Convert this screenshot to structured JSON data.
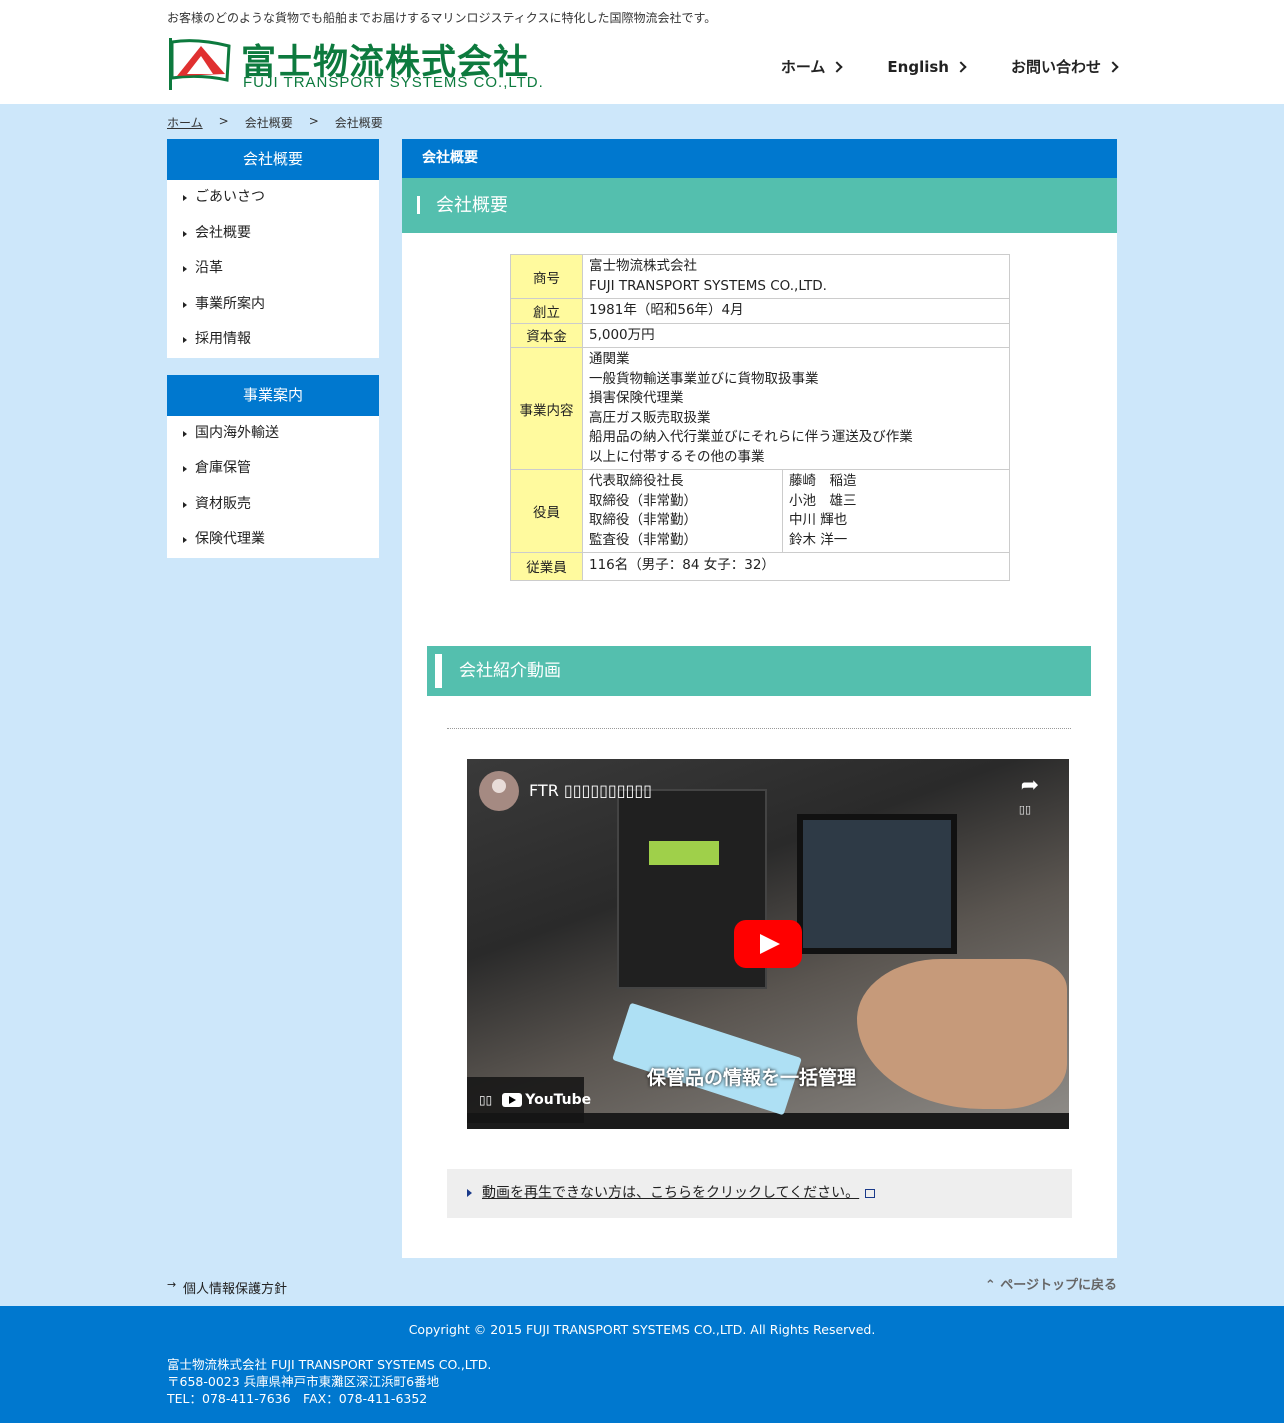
{
  "header": {
    "tagline": "お客様のどのような貨物でも船舶までお届けするマリンロジスティクスに特化した国際物流会社です。",
    "logo_jp": "富士物流株式会社",
    "logo_en": "FUJI TRANSPORT SYSTEMS CO.,LTD.",
    "nav": [
      {
        "label": "ホーム"
      },
      {
        "label": "English"
      },
      {
        "label": "お問い合わせ"
      }
    ]
  },
  "breadcrumb": {
    "home": "ホーム",
    "sep": ">",
    "level1": "会社概要",
    "level2": "会社概要"
  },
  "sidebar": {
    "company": {
      "heading": "会社概要",
      "items": [
        "ごあいさつ",
        "会社概要",
        "沿革",
        "事業所案内",
        "採用情報"
      ]
    },
    "business": {
      "heading": "事業案内",
      "items": [
        "国内海外輸送",
        "倉庫保管",
        "資材販売",
        "保険代理業"
      ]
    }
  },
  "main": {
    "page_heading": "会社概要",
    "section_heading": "会社概要",
    "table": {
      "name_label": "商号",
      "name_jp": "富士物流株式会社",
      "name_en": "FUJI TRANSPORT SYSTEMS CO.,LTD.",
      "founded_label": "創立",
      "founded": "1981年（昭和56年）4月",
      "capital_label": "資本金",
      "capital": "5,000万円",
      "business_label": "事業内容",
      "business_lines": [
        "通関業",
        "一般貨物輸送事業並びに貨物取扱事業",
        "損害保険代理業",
        "高圧ガス販売取扱業",
        "船用品の納入代行業並びにそれらに伴う運送及び作業",
        "以上に付帯するその他の事業"
      ],
      "officers_label": "役員",
      "officer_titles": [
        "代表取締役社長",
        "取締役（非常勤）",
        "取締役（非常勤）",
        "監査役（非常勤）"
      ],
      "officer_names": [
        "藤崎　稲造",
        "小池　雄三",
        "中川 輝也",
        "鈴木 洋一"
      ],
      "employees_label": "従業員",
      "employees": "116名（男子：84 女子：32）"
    },
    "video_heading": "会社紹介動画",
    "video": {
      "title": "FTR ▯▯▯▯▯▯▯▯▯▯",
      "share_label": "▯▯",
      "caption": "保管品の情報を一括管理",
      "watch_label": "▯▯",
      "youtube_label": "YouTube"
    },
    "alt_link": "動画を再生できない方は、こちらをクリックしてください。"
  },
  "footer": {
    "privacy": "個人情報保護方針",
    "pagetop": "ページトップに戻る",
    "copyright": "Copyright © 2015 FUJI TRANSPORT SYSTEMS CO.,LTD. All Rights Reserved.",
    "company": "富士物流株式会社 FUJI TRANSPORT SYSTEMS CO.,LTD.",
    "address": "〒658-0023 兵庫県神戸市東灘区深江浜町6番地",
    "contact": "TEL：078-411-7636　FAX：078-411-6352"
  },
  "colors": {
    "brand_blue": "#0078cf",
    "teal": "#54bfae",
    "page_bg": "#cde7fa",
    "table_head": "#fffa9e",
    "logo_green": "#0d7a3e"
  }
}
